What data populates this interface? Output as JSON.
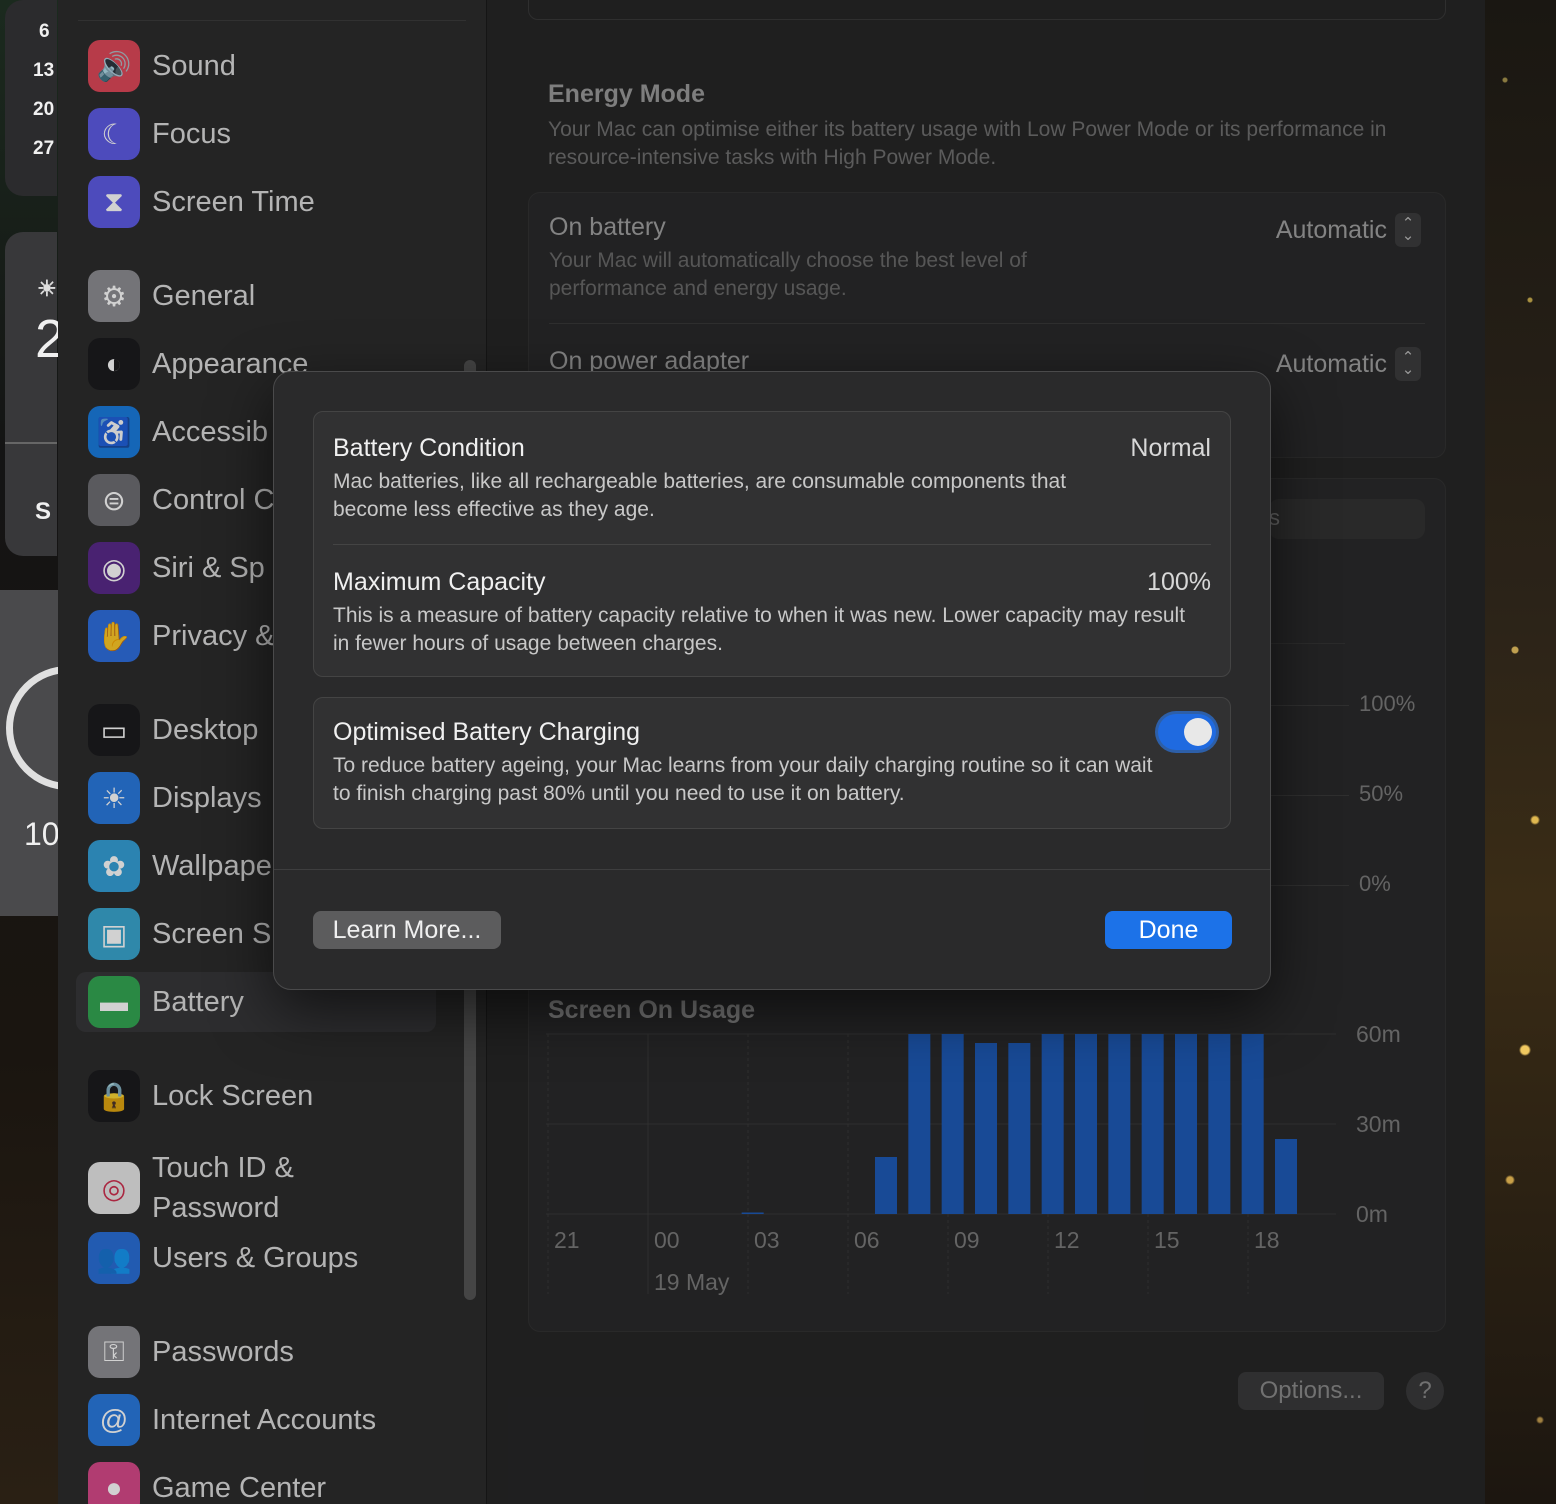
{
  "sidebar": {
    "items": [
      {
        "name": "sound",
        "label": "Sound",
        "icon": "speaker-icon",
        "color": "#e0485a"
      },
      {
        "name": "focus",
        "label": "Focus",
        "icon": "moon-icon",
        "color": "#5e5ce6"
      },
      {
        "name": "screen-time",
        "label": "Screen Time",
        "icon": "hourglass-icon",
        "color": "#5e5ce6"
      },
      {
        "name": "general",
        "label": "General",
        "icon": "gear-icon",
        "color": "#8e8e93"
      },
      {
        "name": "appearance",
        "label": "Appearance",
        "icon": "appearance-icon",
        "color": "#1c1c1e"
      },
      {
        "name": "accessibility",
        "label": "Accessib",
        "icon": "accessibility-icon",
        "color": "#1a7de0"
      },
      {
        "name": "control-centre",
        "label": "Control C",
        "icon": "toggles-icon",
        "color": "#6e6e73"
      },
      {
        "name": "siri",
        "label": "Siri & Sp",
        "icon": "siri-icon",
        "color": "#5a2a8a"
      },
      {
        "name": "privacy",
        "label": "Privacy &",
        "icon": "hand-icon",
        "color": "#2f6fe0"
      },
      {
        "name": "desktop",
        "label": "Desktop",
        "icon": "dock-icon",
        "color": "#1c1c1e"
      },
      {
        "name": "displays",
        "label": "Displays",
        "icon": "sun-icon",
        "color": "#2a7be0"
      },
      {
        "name": "wallpaper",
        "label": "Wallpape",
        "icon": "flower-icon",
        "color": "#35a0d8"
      },
      {
        "name": "screen-saver",
        "label": "Screen S",
        "icon": "screensaver-icon",
        "color": "#3aa6d0"
      },
      {
        "name": "battery",
        "label": "Battery",
        "icon": "battery-icon",
        "color": "#34a853"
      },
      {
        "name": "lock-screen",
        "label": "Lock Screen",
        "icon": "lock-icon",
        "color": "#1c1c1e"
      },
      {
        "name": "touch-id",
        "label": "Touch ID &",
        "label2": "Password",
        "icon": "fingerprint-icon",
        "color": "#e8e8e8"
      },
      {
        "name": "users-groups",
        "label": "Users & Groups",
        "icon": "users-icon",
        "color": "#2a6fd8"
      },
      {
        "name": "passwords",
        "label": "Passwords",
        "icon": "key-icon",
        "color": "#8e8e93"
      },
      {
        "name": "internet-accounts",
        "label": "Internet Accounts",
        "icon": "at-icon",
        "color": "#2a7be0"
      },
      {
        "name": "game-center",
        "label": "Game Center",
        "icon": "gamecenter-icon",
        "color": "#d84a8a"
      }
    ],
    "selected": "Battery"
  },
  "desktop_widgets": {
    "calendar_days": [
      "6",
      "13",
      "20",
      "27"
    ],
    "weather_letter": "2",
    "weather_suffix": "S",
    "clock_text": "10"
  },
  "energy": {
    "title": "Energy Mode",
    "description": "Your Mac can optimise either its battery usage with Low Power Mode or its performance in resource-intensive tasks with High Power Mode.",
    "on_battery": {
      "title": "On battery",
      "value": "Automatic",
      "description": "Your Mac will automatically choose the best level of performance and energy usage."
    },
    "on_adapter": {
      "title": "On power adapter",
      "value": "Automatic"
    }
  },
  "usage": {
    "segment_partial": "s",
    "battery_axis": [
      "100%",
      "50%",
      "0%"
    ],
    "battery_hour_fragment": "3",
    "screen_title": "Screen On Usage"
  },
  "chart_data": {
    "type": "bar",
    "title": "Screen On Usage",
    "categories": [
      "21",
      "22",
      "23",
      "00",
      "01",
      "02",
      "03",
      "04",
      "05",
      "06",
      "07",
      "08",
      "09",
      "10",
      "11",
      "12",
      "13",
      "14",
      "15",
      "16",
      "17",
      "18"
    ],
    "values": [
      0,
      0,
      0,
      0,
      0,
      0.5,
      0,
      0,
      0,
      19,
      60,
      60,
      57,
      57,
      60,
      60,
      60,
      60,
      60,
      60,
      60,
      25
    ],
    "x_tick_labels": [
      "21",
      "00",
      "03",
      "06",
      "09",
      "12",
      "15",
      "18"
    ],
    "x_sublabel": "19 May",
    "y_tick_labels": [
      "60m",
      "30m",
      "0m"
    ],
    "ylim": [
      0,
      60
    ],
    "unit": "minutes",
    "bar_color": "#1e5bb8",
    "grid": true
  },
  "sheet": {
    "battery_condition": {
      "title": "Battery Condition",
      "value": "Normal",
      "description": "Mac batteries, like all rechargeable batteries, are consumable components that become less effective as they age."
    },
    "maximum_capacity": {
      "title": "Maximum Capacity",
      "value": "100%",
      "description": "This is a measure of battery capacity relative to when it was new. Lower capacity may result in fewer hours of usage between charges."
    },
    "optimised_charging": {
      "title": "Optimised Battery Charging",
      "enabled": true,
      "description": "To reduce battery ageing, your Mac learns from your daily charging routine so it can wait to finish charging past 80% until you need to use it on battery."
    },
    "learn_more_label": "Learn More...",
    "done_label": "Done"
  },
  "footer": {
    "options_label": "Options...",
    "help_label": "?"
  },
  "colors": {
    "accent": "#1c72e8",
    "toggle_on": "#1f6ae0"
  }
}
